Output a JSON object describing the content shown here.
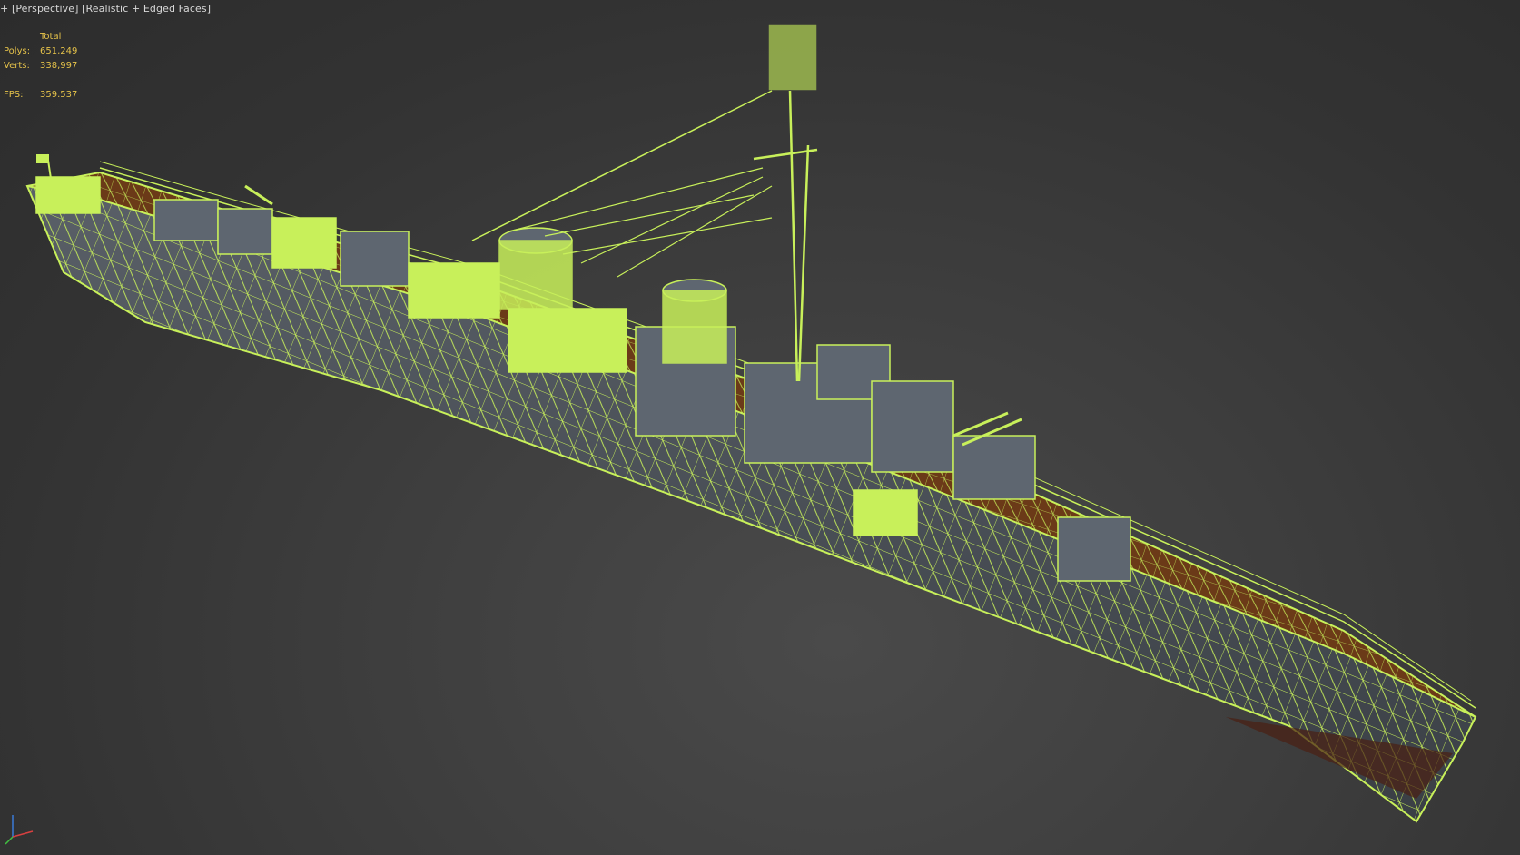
{
  "viewport": {
    "menu_plus": "+",
    "view_name": "[Perspective]",
    "shading_mode": "[Realistic + Edged Faces]"
  },
  "stats": {
    "header": "Total",
    "polys_label": "Polys:",
    "polys_value": "651,249",
    "verts_label": "Verts:",
    "verts_value": "338,997",
    "fps_label": "FPS:",
    "fps_value": "359.537"
  },
  "colors": {
    "wireframe": "#c8f05a",
    "hull_dark": "#474d55",
    "deck_wood": "#6b3a18",
    "stats_text": "#e6c34a",
    "label_text": "#d8d8d8"
  },
  "icons": {
    "axis_gizmo": "xyz-axis-gizmo"
  }
}
